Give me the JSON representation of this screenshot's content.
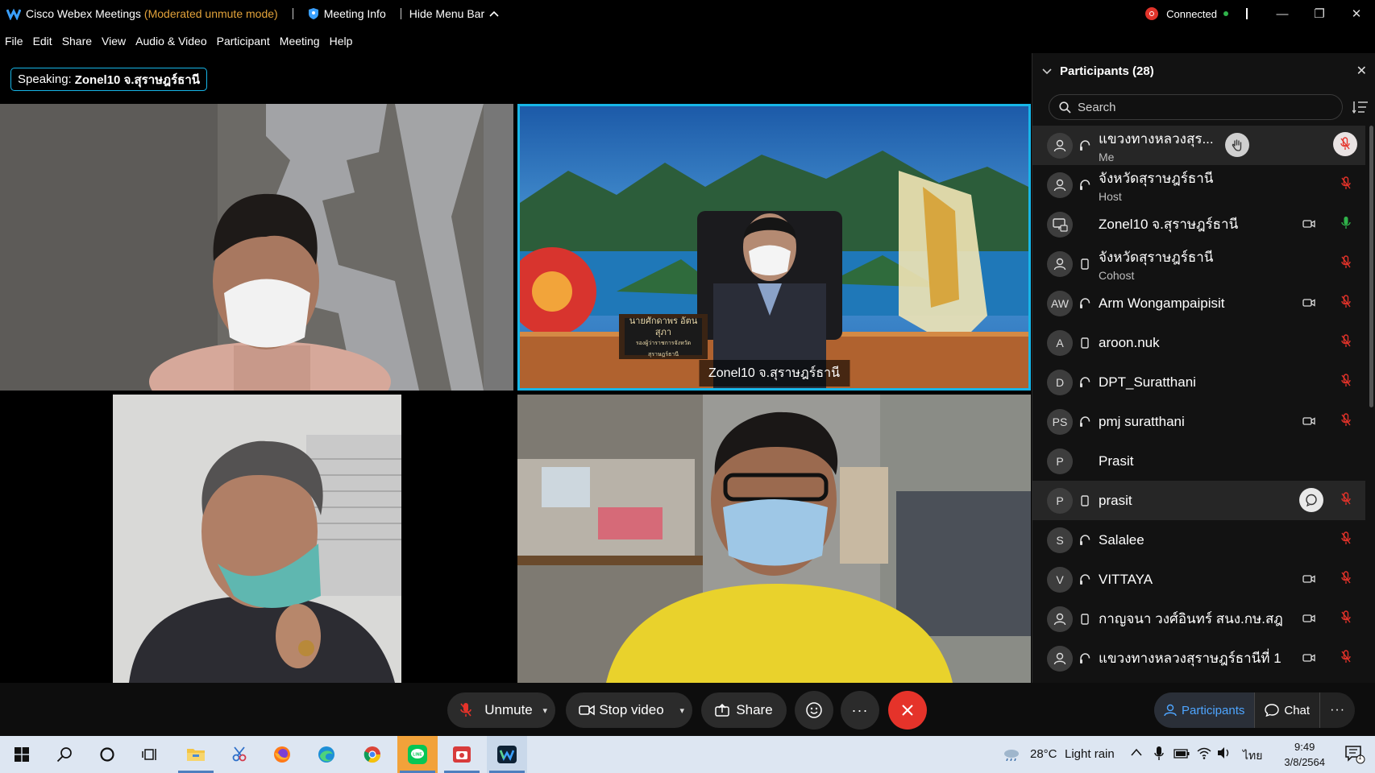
{
  "titlebar": {
    "app_name": "Cisco Webex Meetings",
    "mode": "(Moderated unmute mode)",
    "meeting_info": "Meeting Info",
    "hide_menu": "Hide Menu Bar",
    "status": "Connected"
  },
  "menu": [
    "File",
    "Edit",
    "Share",
    "View",
    "Audio & Video",
    "Participant",
    "Meeting",
    "Help"
  ],
  "speaking": {
    "prefix": "Speaking:",
    "name": "Zonel10 จ.สุราษฎร์ธานี"
  },
  "video_tiles": {
    "tile2_label": "Zonel10 จ.สุราษฎร์ธานี",
    "nameplate_line1": "นายศักดาพร อัตนสุภา",
    "nameplate_line2": "รองผู้ว่าราชการจังหวัดสุราษฎร์ธานี"
  },
  "participants": {
    "header": "Participants (28)",
    "search_placeholder": "Search",
    "items": [
      {
        "initials": "",
        "name": "แขวงทางหลวงสุร...",
        "role": "Me",
        "device": "headset",
        "video": false,
        "mic": "muted",
        "badge": "raise-hand",
        "highlight": true
      },
      {
        "initials": "",
        "name": "จังหวัดสุราษฎร์ธานี",
        "role": "Host",
        "device": "headset",
        "video": false,
        "mic": "muted"
      },
      {
        "initials": "",
        "name": "Zonel10 จ.สุราษฎร์ธานี",
        "role": "",
        "device": "room",
        "video": true,
        "mic": "active"
      },
      {
        "initials": "",
        "name": "จังหวัดสุราษฎร์ธานี",
        "role": "Cohost",
        "device": "phone",
        "video": false,
        "mic": "muted"
      },
      {
        "initials": "AW",
        "name": "Arm Wongampaipisit",
        "role": "",
        "device": "headset",
        "video": true,
        "mic": "muted"
      },
      {
        "initials": "A",
        "name": "aroon.nuk",
        "role": "",
        "device": "phone",
        "video": false,
        "mic": "muted"
      },
      {
        "initials": "D",
        "name": "DPT_Suratthani",
        "role": "",
        "device": "headset",
        "video": false,
        "mic": "muted"
      },
      {
        "initials": "PS",
        "name": "pmj suratthani",
        "role": "",
        "device": "headset",
        "video": true,
        "mic": "muted"
      },
      {
        "initials": "P",
        "name": "Prasit",
        "role": "",
        "device": "none",
        "video": false,
        "mic": "none"
      },
      {
        "initials": "P",
        "name": "prasit",
        "role": "",
        "device": "phone",
        "video": false,
        "mic": "muted",
        "badge": "chat",
        "highlight": true
      },
      {
        "initials": "S",
        "name": "Salalee",
        "role": "",
        "device": "headset",
        "video": false,
        "mic": "muted"
      },
      {
        "initials": "V",
        "name": "VITTAYA",
        "role": "",
        "device": "headset",
        "video": true,
        "mic": "muted"
      },
      {
        "initials": "",
        "name": "กาญจนา วงศ์อินทร์ สนง.กษ.สฎ",
        "role": "",
        "device": "phone",
        "video": true,
        "mic": "muted"
      },
      {
        "initials": "",
        "name": "แขวงทางหลวงสุราษฎร์ธานีที่ 1",
        "role": "",
        "device": "headset",
        "video": true,
        "mic": "muted"
      }
    ]
  },
  "controls": {
    "unmute": "Unmute",
    "stop_video": "Stop video",
    "share": "Share",
    "participants": "Participants",
    "chat": "Chat"
  },
  "taskbar": {
    "temperature": "28°C",
    "weather": "Light rain",
    "language": "ไทย",
    "time": "9:49",
    "date": "3/8/2564",
    "notification_count": "1"
  },
  "colors": {
    "accent": "#17b6e8",
    "end_call": "#e5332a",
    "mute_red": "#e5332a",
    "mic_green": "#2fb34a",
    "mode_orange": "#e2a23a",
    "active_blue": "#4ea5ff"
  }
}
